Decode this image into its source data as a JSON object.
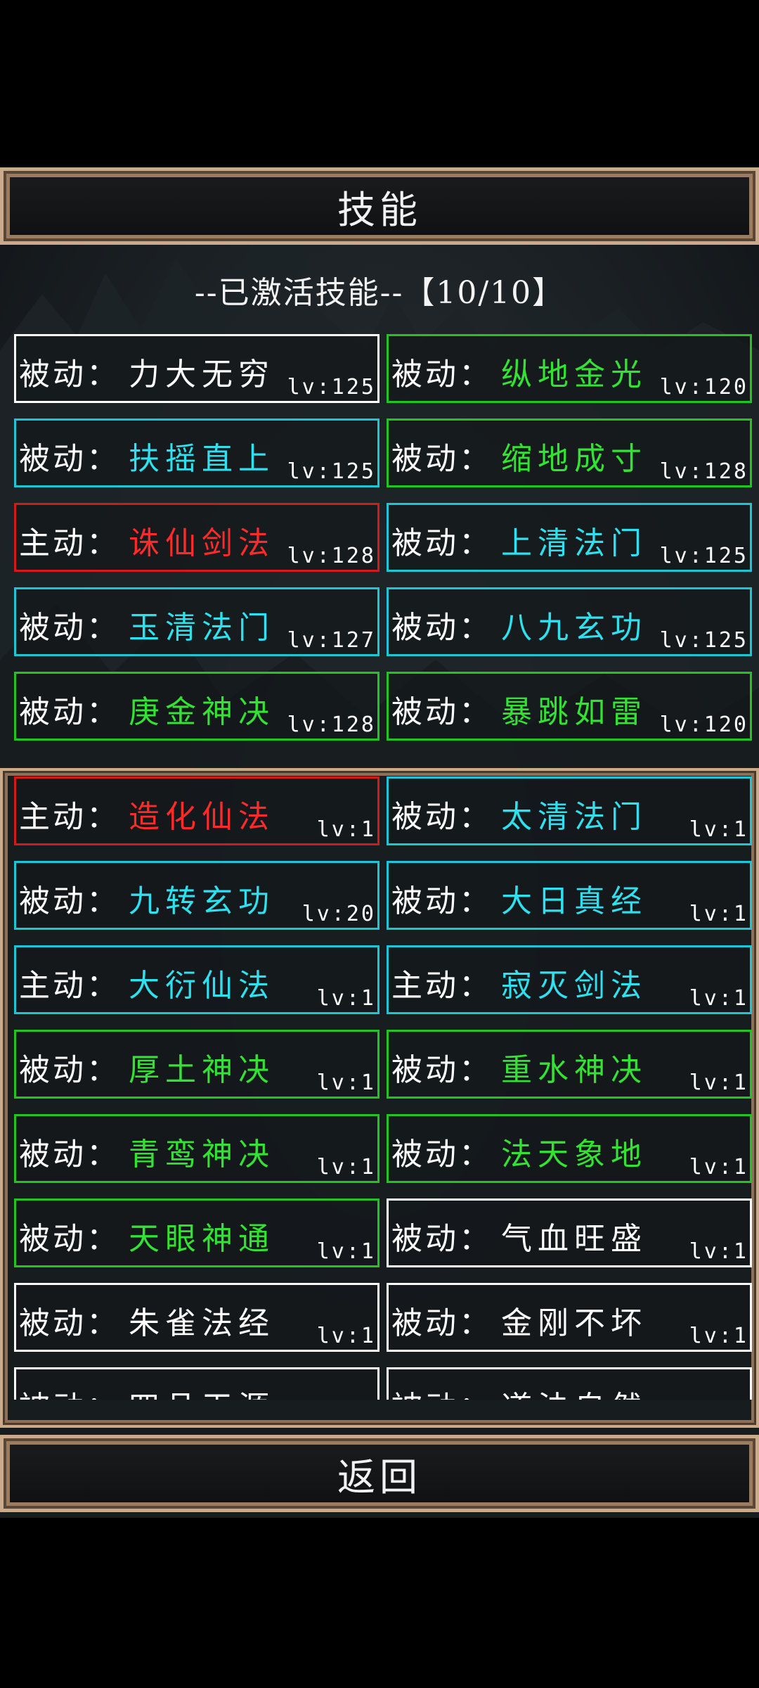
{
  "header": {
    "title": "技能"
  },
  "active_section": {
    "label": "--已激活技能--【10/10】"
  },
  "colors": {
    "white": "#ffffff",
    "green": "#33e233",
    "cyan": "#2fe0ee",
    "red": "#ff2a2a",
    "frame": "#c9aa8b"
  },
  "active_skills": [
    {
      "type": "被动：",
      "name": "力大无穷",
      "level": "lv:125",
      "color": "white"
    },
    {
      "type": "被动：",
      "name": "纵地金光",
      "level": "lv:120",
      "color": "green"
    },
    {
      "type": "被动：",
      "name": "扶摇直上",
      "level": "lv:125",
      "color": "cyan"
    },
    {
      "type": "被动：",
      "name": "缩地成寸",
      "level": "lv:128",
      "color": "green"
    },
    {
      "type": "主动：",
      "name": "诛仙剑法",
      "level": "lv:128",
      "color": "red"
    },
    {
      "type": "被动：",
      "name": "上清法门",
      "level": "lv:125",
      "color": "cyan"
    },
    {
      "type": "被动：",
      "name": "玉清法门",
      "level": "lv:127",
      "color": "cyan"
    },
    {
      "type": "被动：",
      "name": "八九玄功",
      "level": "lv:125",
      "color": "cyan"
    },
    {
      "type": "被动：",
      "name": "庚金神决",
      "level": "lv:128",
      "color": "green"
    },
    {
      "type": "被动：",
      "name": "暴跳如雷",
      "level": "lv:120",
      "color": "green"
    }
  ],
  "skill_list": [
    {
      "type": "主动：",
      "name": "造化仙法",
      "level": "lv:1",
      "color": "red"
    },
    {
      "type": "被动：",
      "name": "太清法门",
      "level": "lv:1",
      "color": "cyan"
    },
    {
      "type": "被动：",
      "name": "九转玄功",
      "level": "lv:20",
      "color": "cyan"
    },
    {
      "type": "被动：",
      "name": "大日真经",
      "level": "lv:1",
      "color": "cyan"
    },
    {
      "type": "主动：",
      "name": "大衍仙法",
      "level": "lv:1",
      "color": "cyan"
    },
    {
      "type": "主动：",
      "name": "寂灭剑法",
      "level": "lv:1",
      "color": "cyan"
    },
    {
      "type": "被动：",
      "name": "厚土神决",
      "level": "lv:1",
      "color": "green"
    },
    {
      "type": "被动：",
      "name": "重水神决",
      "level": "lv:1",
      "color": "green"
    },
    {
      "type": "被动：",
      "name": "青鸾神决",
      "level": "lv:1",
      "color": "green"
    },
    {
      "type": "被动：",
      "name": "法天象地",
      "level": "lv:1",
      "color": "green"
    },
    {
      "type": "被动：",
      "name": "天眼神通",
      "level": "lv:1",
      "color": "green"
    },
    {
      "type": "被动：",
      "name": "气血旺盛",
      "level": "lv:1",
      "color": "white"
    },
    {
      "type": "被动：",
      "name": "朱雀法经",
      "level": "lv:1",
      "color": "white"
    },
    {
      "type": "被动：",
      "name": "金刚不坏",
      "level": "lv:1",
      "color": "white"
    },
    {
      "type": "被动：",
      "name": "四品天源",
      "level": "",
      "color": "white"
    },
    {
      "type": "被动：",
      "name": "道法自然",
      "level": "",
      "color": "white"
    }
  ],
  "footer": {
    "return_label": "返回"
  }
}
